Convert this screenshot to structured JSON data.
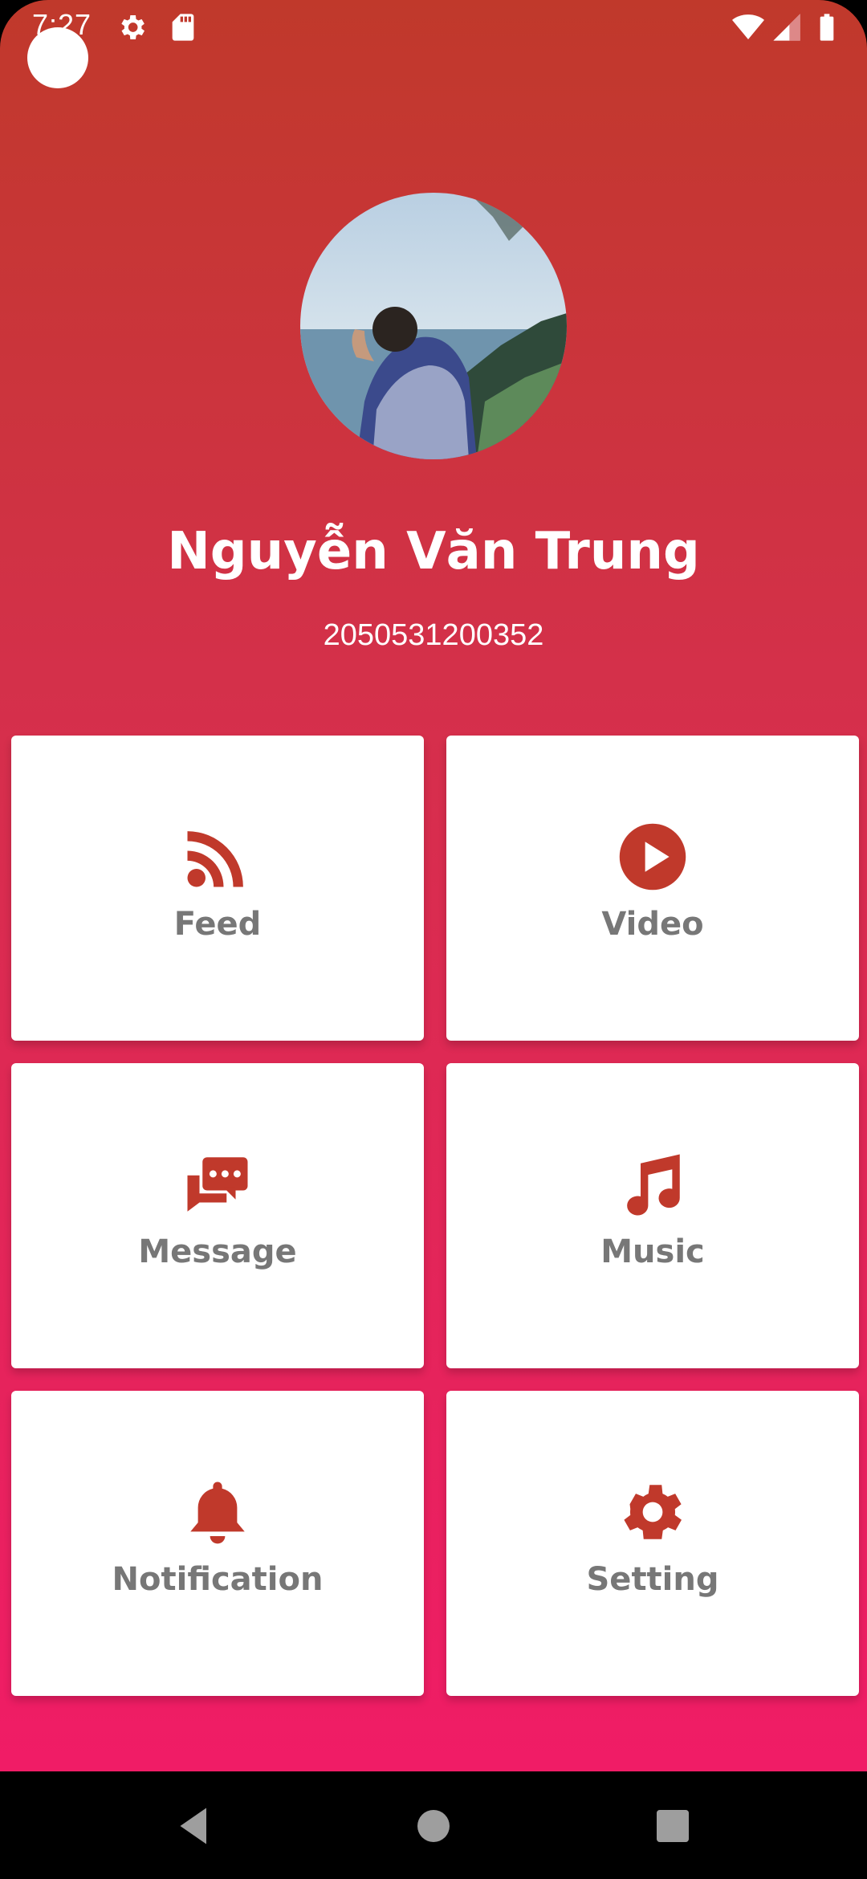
{
  "status_bar": {
    "time": "7:27",
    "icons": [
      "gear-icon",
      "sd-card-icon",
      "wifi-icon",
      "signal-icon",
      "battery-icon"
    ]
  },
  "profile": {
    "name": "Nguyễn Văn Trung",
    "student_id": "2050531200352"
  },
  "menu": [
    {
      "label": "Feed",
      "icon": "rss-icon"
    },
    {
      "label": "Video",
      "icon": "play-circle-icon"
    },
    {
      "label": "Message",
      "icon": "chat-bubbles-icon"
    },
    {
      "label": "Music",
      "icon": "music-note-icon"
    },
    {
      "label": "Notification",
      "icon": "bell-icon"
    },
    {
      "label": "Setting",
      "icon": "gear-icon"
    }
  ],
  "nav_bar": {
    "buttons": [
      "back-icon",
      "home-icon",
      "recents-icon"
    ]
  },
  "colors": {
    "gradient_top": "#c0392b",
    "gradient_bottom": "#f01c66",
    "icon_red": "#c0392b",
    "label_gray": "#777777",
    "tile_bg": "#ffffff"
  }
}
